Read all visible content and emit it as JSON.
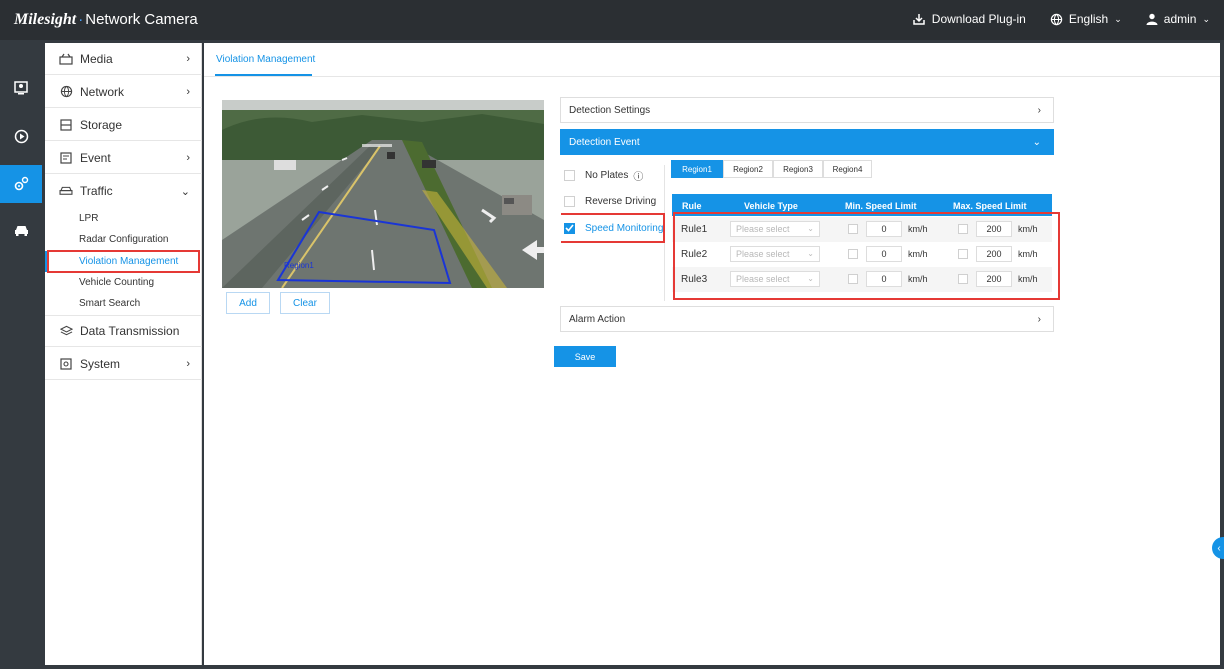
{
  "header": {
    "brand": "Milesight",
    "product": "Network Camera",
    "download": "Download Plug-in",
    "language": "English",
    "user": "admin"
  },
  "sidebar": {
    "items": [
      {
        "label": "Media"
      },
      {
        "label": "Network"
      },
      {
        "label": "Storage"
      },
      {
        "label": "Event"
      },
      {
        "label": "Traffic"
      },
      {
        "label": "Data Transmission"
      },
      {
        "label": "System"
      }
    ],
    "traffic_sub": [
      "LPR",
      "Radar Configuration",
      "Violation Management",
      "Vehicle Counting",
      "Smart Search"
    ]
  },
  "main": {
    "tab": "Violation Management",
    "region_label": "Region1",
    "add_label": "Add",
    "clear_label": "Clear",
    "detection_settings": "Detection Settings",
    "detection_event": "Detection Event",
    "alarm_action": "Alarm Action",
    "save_label": "Save",
    "event_options": [
      {
        "label": "No Plates",
        "checked": false
      },
      {
        "label": "Reverse Driving",
        "checked": false
      },
      {
        "label": "Speed Monitoring",
        "checked": true
      }
    ],
    "info_glyph": "ⓘ",
    "region_tabs": [
      "Region1",
      "Region2",
      "Region3",
      "Region4"
    ],
    "table": {
      "headers": [
        "Rule",
        "Vehicle Type",
        "Min. Speed Limit",
        "Max. Speed Limit"
      ],
      "rows": [
        {
          "rule": "Rule1",
          "vehicle_type_placeholder": "Please select",
          "min": "0",
          "max": "200",
          "unit": "km/h"
        },
        {
          "rule": "Rule2",
          "vehicle_type_placeholder": "Please select",
          "min": "0",
          "max": "200",
          "unit": "km/h"
        },
        {
          "rule": "Rule3",
          "vehicle_type_placeholder": "Please select",
          "min": "0",
          "max": "200",
          "unit": "km/h"
        }
      ]
    }
  },
  "colors": {
    "accent": "#1593e6",
    "highlight": "#e53935",
    "topbar": "#2b2f33"
  }
}
